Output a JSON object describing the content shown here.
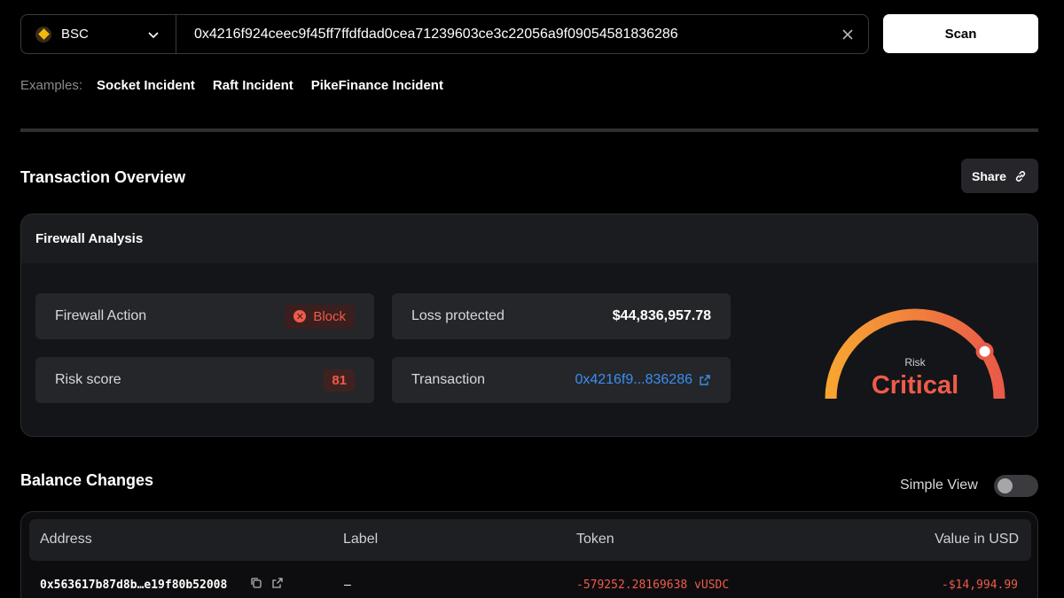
{
  "search": {
    "chain": "BSC",
    "tx_hash": "0x4216f924ceec9f45ff7ffdfdad0cea71239603ce3c22056a9f09054581836286",
    "scan_label": "Scan"
  },
  "examples": {
    "label": "Examples:",
    "items": [
      "Socket Incident",
      "Raft Incident",
      "PikeFinance Incident"
    ]
  },
  "overview": {
    "title": "Transaction Overview",
    "share_label": "Share"
  },
  "firewall": {
    "title": "Firewall Analysis",
    "action_label": "Firewall Action",
    "action_value": "Block",
    "risk_score_label": "Risk score",
    "risk_score_value": "81",
    "loss_label": "Loss protected",
    "loss_value": "$44,836,957.78",
    "transaction_label": "Transaction",
    "transaction_value": "0x4216f9...836286",
    "gauge": {
      "caption": "Risk",
      "level": "Critical",
      "score_fraction": 0.81,
      "colors": {
        "start": "#f7a531",
        "end": "#ea5a48"
      }
    }
  },
  "balance": {
    "title": "Balance Changes",
    "simple_view_label": "Simple View",
    "simple_view_on": false,
    "columns": [
      "Address",
      "Label",
      "Token",
      "Value in USD"
    ],
    "rows": [
      {
        "address": "0x563617b87d8b…e19f80b52008",
        "label": "–",
        "token": "-579252.28169638 vUSDC",
        "value": "-$14,994.99"
      }
    ]
  },
  "colors": {
    "background": "#000000",
    "danger": "#ef5b4a",
    "link": "#3a8ef0"
  }
}
